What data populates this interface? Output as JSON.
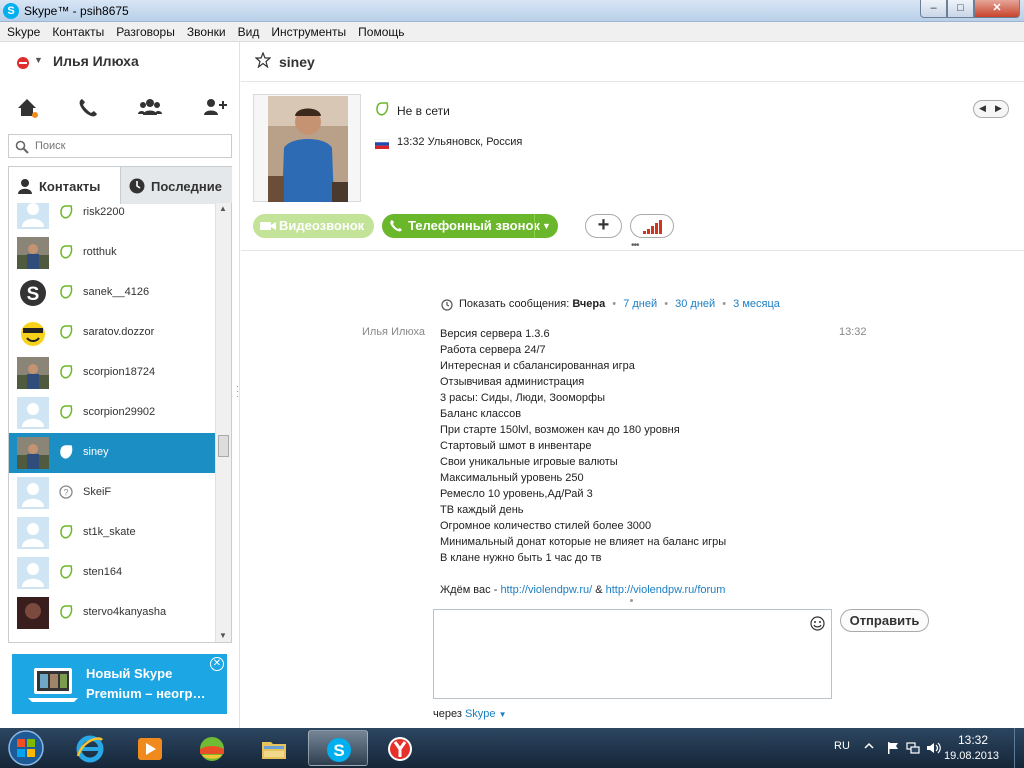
{
  "window": {
    "title": "Skype™ - psih8675",
    "min": "–",
    "max": "□",
    "close": "✕"
  },
  "menu": [
    "Skype",
    "Контакты",
    "Разговоры",
    "Звонки",
    "Вид",
    "Инструменты",
    "Помощь"
  ],
  "profile": {
    "name": "Илья Илюха"
  },
  "search": {
    "placeholder": "Поиск"
  },
  "tabs": {
    "contacts": "Контакты",
    "recent": "Последние"
  },
  "contacts": [
    {
      "name": "risk2200",
      "avatar": "default",
      "status": "offline"
    },
    {
      "name": "rotthuk",
      "avatar": "photo",
      "status": "offline"
    },
    {
      "name": "sanek__4126",
      "avatar": "skype",
      "status": "offline"
    },
    {
      "name": "saratov.dozzor",
      "avatar": "smiley",
      "status": "offline"
    },
    {
      "name": "scorpion18724",
      "avatar": "photo",
      "status": "offline"
    },
    {
      "name": "scorpion29902",
      "avatar": "default",
      "status": "offline"
    },
    {
      "name": "siney",
      "avatar": "photo",
      "status": "offline",
      "selected": true
    },
    {
      "name": "SkeiF",
      "avatar": "default",
      "status": "unknown"
    },
    {
      "name": "st1k_skate",
      "avatar": "default",
      "status": "offline"
    },
    {
      "name": "sten164",
      "avatar": "default",
      "status": "offline"
    },
    {
      "name": "stervo4kanyasha",
      "avatar": "photo-dark",
      "status": "offline"
    }
  ],
  "ad": {
    "line1": "Новый Skype",
    "line2": "Premium – неогр…",
    "close": "✕"
  },
  "chat": {
    "contact_name": "siney",
    "status_text": "Не в сети",
    "location_text": "13:32 Ульяновск, Россия",
    "video_button": "Видеозвонок",
    "call_button": "Телефонный звонок",
    "plus_button": "+",
    "history": {
      "label": "Показать сообщения:",
      "current": "Вчера",
      "sep": "•",
      "opt1": "7 дней",
      "opt2": "30 дней",
      "opt3": "3 месяца"
    },
    "message": {
      "sender": "Илья Илюха",
      "time": "13:32",
      "lines": [
        "Версия сервера 1.3.6",
        "Работа сервера 24/7",
        "Интересная и сбалансированная игра",
        "Отзывчивая администрация",
        "3 расы: Сиды, Люди, Зооморфы",
        "Баланс классов",
        "При старте 150lvl, возможен кач до 180 уровня",
        "Стартовый шмот в инвентаре",
        "Свои уникальные игровые валюты",
        "Максимальный уровень 250",
        "Ремесло 10 уровень,Ад/Рай 3",
        "ТВ каждый день",
        "Огромное количество стилей более 3000",
        "Минимальный донат которые не влияет на баланс игры",
        "В клане нужно быть 1 час до тв"
      ],
      "footer_prefix": "Ждём вас - ",
      "link1": "http://violendpw.ru/",
      "footer_mid": " & ",
      "link2": "http://violendpw.ru/forum"
    },
    "send_button": "Отправить",
    "via_prefix": "через",
    "via_link": "Skype",
    "via_arrow": "▼"
  },
  "taskbar": {
    "lang": "RU",
    "time": "13:32",
    "date": "19.08.2013"
  },
  "colors": {
    "accent": "#00aff0",
    "selected": "#1b8fc4",
    "call_green": "#6bb72c",
    "link": "#1b7fc4"
  }
}
